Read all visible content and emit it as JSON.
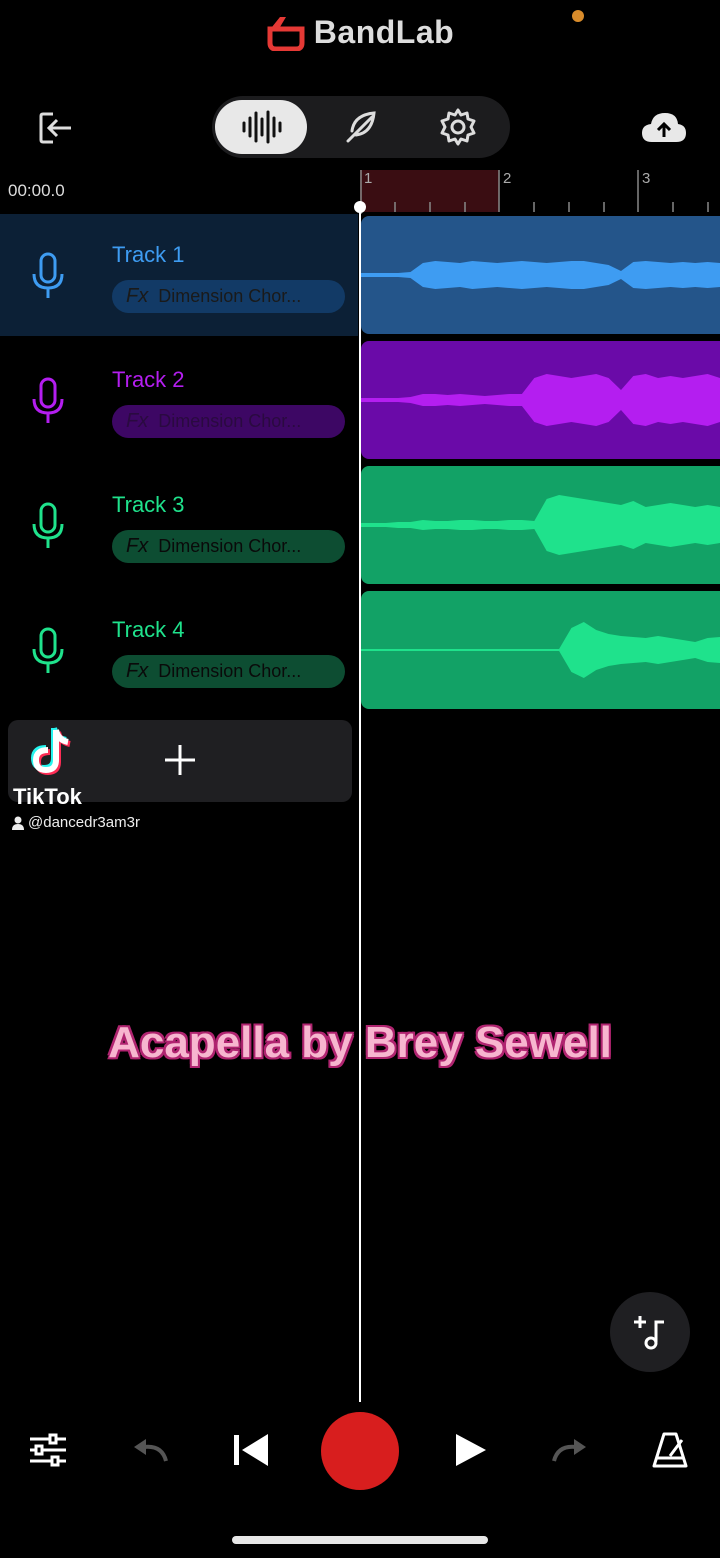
{
  "app": {
    "title": "BandLab"
  },
  "toolbar": {
    "modes": [
      "waveform",
      "effects",
      "settings"
    ],
    "active_mode": "waveform"
  },
  "timeline": {
    "time": "00:00.0",
    "bars": [
      "1",
      "2",
      "3"
    ]
  },
  "tracks": [
    {
      "name": "Track 1",
      "effect": "Dimension Chor...",
      "fx_label": "Fx",
      "color": "#3e9cf2",
      "clip_bg": "#24558a",
      "head_bg": "#0c2036",
      "fx_bg": "#123a66",
      "fx_text": "#1a1a1a",
      "selected": true
    },
    {
      "name": "Track 2",
      "effect": "Dimension Chor...",
      "fx_label": "Fx",
      "color": "#b41ef0",
      "clip_bg": "#6a0aa8",
      "head_bg": "#000000",
      "fx_bg": "#3d0764",
      "fx_text": "#2a0a40",
      "selected": false
    },
    {
      "name": "Track 3",
      "effect": "Dimension Chor...",
      "fx_label": "Fx",
      "color": "#1fe28c",
      "clip_bg": "#12a266",
      "head_bg": "#000000",
      "fx_bg": "#0d4d32",
      "fx_text": "#0a0a0a",
      "selected": false
    },
    {
      "name": "Track 4",
      "effect": "Dimension Chor...",
      "fx_label": "Fx",
      "color": "#1fe28c",
      "clip_bg": "#12a266",
      "head_bg": "#000000",
      "fx_bg": "#0d4d32",
      "fx_text": "#0a0a0a",
      "selected": false
    }
  ],
  "watermark": {
    "brand": "TikTok",
    "user": "@dancedr3am3r"
  },
  "caption": "Acapella by Brey Sewell",
  "transport": {
    "buttons": [
      "mixer",
      "undo",
      "skip-back",
      "record",
      "play",
      "redo",
      "metronome"
    ]
  },
  "colors": {
    "accent": "#d81e1e",
    "background": "#000000"
  }
}
